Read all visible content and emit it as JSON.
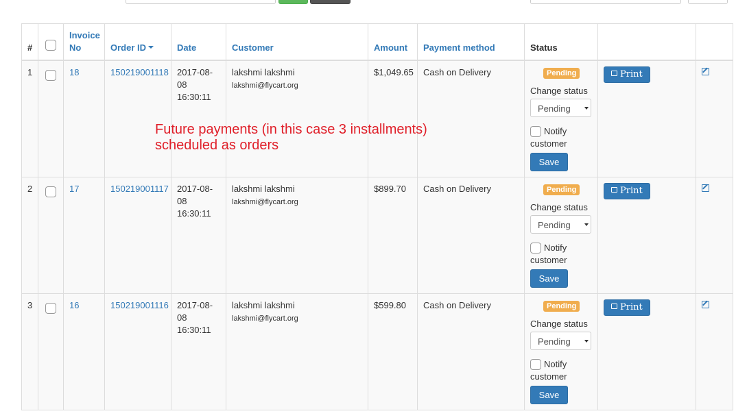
{
  "colors": {
    "link": "#337ab7",
    "pending_badge": "#f0ad4e",
    "primary_button": "#337ab7",
    "annotation": "#e0202a"
  },
  "table": {
    "headers": {
      "hash": "#",
      "invoice": "Invoice No",
      "order_id": "Order ID",
      "date": "Date",
      "customer": "Customer",
      "amount": "Amount",
      "payment_method": "Payment method",
      "status": "Status"
    },
    "rows": [
      {
        "num": "1",
        "invoice": "18",
        "order_id": "150219001118",
        "date": "2017-08-08",
        "time": "16:30:11",
        "customer_name": "lakshmi lakshmi",
        "customer_email": "lakshmi@flycart.org",
        "amount": "$1,049.65",
        "payment_method": "Cash on Delivery",
        "status": "Pending",
        "change_status_label": "Change status",
        "status_select": "Pending",
        "notify_label": "Notify",
        "notify_label2": "customer",
        "save_label": "Save",
        "print_label": "Print",
        "edit_icon": "edit-icon"
      },
      {
        "num": "2",
        "invoice": "17",
        "order_id": "150219001117",
        "date": "2017-08-08",
        "time": "16:30:11",
        "customer_name": "lakshmi lakshmi",
        "customer_email": "lakshmi@flycart.org",
        "amount": "$899.70",
        "payment_method": "Cash on Delivery",
        "status": "Pending",
        "change_status_label": "Change status",
        "status_select": "Pending",
        "notify_label": "Notify",
        "notify_label2": "customer",
        "save_label": "Save",
        "print_label": "Print",
        "edit_icon": "edit-icon"
      },
      {
        "num": "3",
        "invoice": "16",
        "order_id": "150219001116",
        "date": "2017-08-08",
        "time": "16:30:11",
        "customer_name": "lakshmi lakshmi",
        "customer_email": "lakshmi@flycart.org",
        "amount": "$599.80",
        "payment_method": "Cash on Delivery",
        "status": "Pending",
        "change_status_label": "Change status",
        "status_select": "Pending",
        "notify_label": "Notify",
        "notify_label2": "customer",
        "save_label": "Save",
        "print_label": "Print",
        "edit_icon": "edit-icon"
      }
    ]
  },
  "annotation": {
    "line1": "Future payments (in this case 3 installments)",
    "line2": "scheduled as orders"
  }
}
